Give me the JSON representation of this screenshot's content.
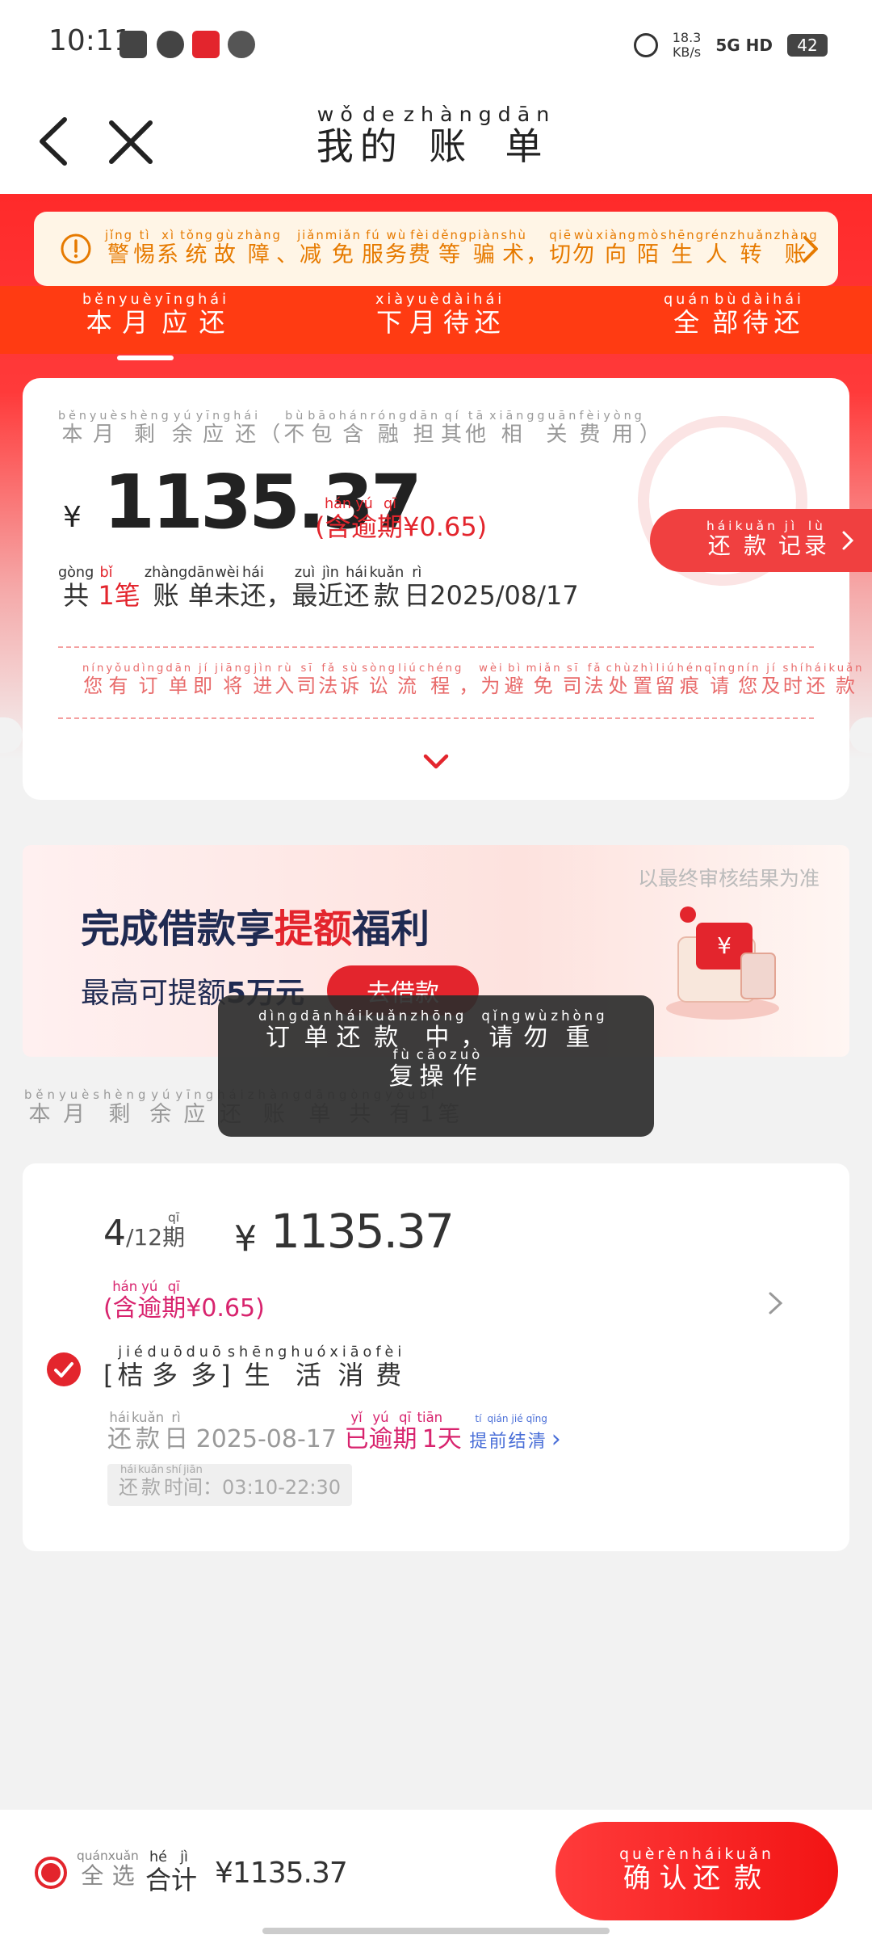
{
  "status_bar": {
    "time": "10:11",
    "speed": "18.3",
    "speed_unit": "KB/s",
    "network": "5G HD",
    "battery": "42"
  },
  "header": {
    "title": [
      [
        "我",
        "wǒ"
      ],
      [
        "的",
        "de"
      ],
      [
        "账",
        "zhàng"
      ],
      [
        "单",
        "dān"
      ]
    ]
  },
  "notice": {
    "text": [
      [
        "警",
        "jǐng"
      ],
      [
        "惕",
        "tì"
      ],
      [
        "系",
        "xì"
      ],
      [
        "统",
        "tǒng"
      ],
      [
        "故",
        "gù"
      ],
      [
        "障",
        "zhàng"
      ],
      [
        "、",
        ""
      ],
      [
        "减",
        "jiǎn"
      ],
      [
        "免",
        "miǎn"
      ],
      [
        "服",
        "fú"
      ],
      [
        "务",
        "wù"
      ],
      [
        "费",
        "fèi"
      ],
      [
        "等",
        "děng"
      ],
      [
        "骗",
        "piàn"
      ],
      [
        "术",
        "shù"
      ],
      [
        "，",
        ""
      ],
      [
        "切",
        "qiē"
      ],
      [
        "勿",
        "wù"
      ],
      [
        "向",
        "xiàng"
      ],
      [
        "陌",
        "mò"
      ],
      [
        "生",
        "shēng"
      ],
      [
        "人",
        "rén"
      ],
      [
        "转",
        "zhuǎn"
      ],
      [
        "账",
        "zhàng"
      ]
    ]
  },
  "tabs": [
    [
      [
        "本",
        "běn"
      ],
      [
        "月",
        "yuè"
      ],
      [
        "应",
        "yīng"
      ],
      [
        "还",
        "hái"
      ]
    ],
    [
      [
        "下",
        "xià"
      ],
      [
        "月",
        "yuè"
      ],
      [
        "待",
        "dài"
      ],
      [
        "还",
        "hái"
      ]
    ],
    [
      [
        "全",
        "quán"
      ],
      [
        "部",
        "bù"
      ],
      [
        "待",
        "dài"
      ],
      [
        "还",
        "hái"
      ]
    ]
  ],
  "summary": {
    "label": [
      [
        "本",
        "běn"
      ],
      [
        "月",
        "yuè"
      ],
      [
        "剩",
        "shèng"
      ],
      [
        "余",
        "yú"
      ],
      [
        "应",
        "yīng"
      ],
      [
        "还",
        "hái"
      ],
      [
        "（",
        ""
      ],
      [
        "不",
        "bù"
      ],
      [
        "包",
        "bāo"
      ],
      [
        "含",
        "hán"
      ],
      [
        "融",
        "róng"
      ],
      [
        "担",
        "dān"
      ],
      [
        "其",
        "qí"
      ],
      [
        "他",
        "tā"
      ],
      [
        "相",
        "xiāng"
      ],
      [
        "关",
        "guān"
      ],
      [
        "费",
        "fèi"
      ],
      [
        "用",
        "yòng"
      ],
      [
        "）",
        ""
      ]
    ],
    "currency": "¥",
    "amount": "1135.37",
    "overdue_prefix": [
      [
        "(",
        ""
      ],
      [
        "含",
        "hán"
      ],
      [
        "逾",
        "yú"
      ],
      [
        "期",
        "qī"
      ]
    ],
    "overdue_value": "¥0.65)",
    "history_button": [
      [
        "还",
        "hái"
      ],
      [
        "款",
        "kuǎn"
      ],
      [
        "记",
        "jì"
      ],
      [
        "录",
        "lù"
      ]
    ],
    "count_pre": [
      [
        "共",
        "gòng"
      ]
    ],
    "count_num": [
      [
        "1",
        "bǐ"
      ],
      [
        "笔",
        ""
      ]
    ],
    "count_mid": [
      [
        "账",
        "zhàng"
      ],
      [
        "单",
        "dān"
      ],
      [
        "未",
        "wèi"
      ],
      [
        "还",
        "hái"
      ],
      [
        "，",
        ""
      ],
      [
        "最",
        "zuì"
      ],
      [
        "近",
        "jìn"
      ],
      [
        "还",
        "hái"
      ],
      [
        "款",
        "kuǎn"
      ],
      [
        "日",
        "rì"
      ]
    ],
    "count_date": "2025/08/17",
    "legal_notice": [
      [
        "您",
        "nín"
      ],
      [
        "有",
        "yǒu"
      ],
      [
        "订",
        "dìng"
      ],
      [
        "单",
        "dān"
      ],
      [
        "即",
        "jí"
      ],
      [
        "将",
        "jiāng"
      ],
      [
        "进",
        "jìn"
      ],
      [
        "入",
        "rù"
      ],
      [
        "司",
        "sī"
      ],
      [
        "法",
        "fǎ"
      ],
      [
        "诉",
        "sù"
      ],
      [
        "讼",
        "sòng"
      ],
      [
        "流",
        "liú"
      ],
      [
        "程",
        "chéng"
      ],
      [
        "，",
        ""
      ],
      [
        "为",
        "wèi"
      ],
      [
        "避",
        "bì"
      ],
      [
        "免",
        "miǎn"
      ],
      [
        "司",
        "sī"
      ],
      [
        "法",
        "fǎ"
      ],
      [
        "处",
        "chù"
      ],
      [
        "置",
        "zhì"
      ],
      [
        "留",
        "liú"
      ],
      [
        "痕",
        "hén"
      ],
      [
        "请",
        "qǐng"
      ],
      [
        "您",
        "nín"
      ],
      [
        "及",
        "jí"
      ],
      [
        "时",
        "shí"
      ],
      [
        "还",
        "hái"
      ],
      [
        "款",
        "kuǎn"
      ]
    ]
  },
  "banner": {
    "disclaimer": "以最终审核结果为准",
    "title_pre": "完成借款享",
    "title_highlight": "提额",
    "title_post": "福利",
    "sub_pre": "最高可提额",
    "sub_bold": "5万元",
    "button": "去借款"
  },
  "section_label": [
    [
      "本",
      "běn"
    ],
    [
      "月",
      "yuè"
    ],
    [
      "剩",
      "shèng"
    ],
    [
      "余",
      "yú"
    ],
    [
      "应",
      "yīng"
    ],
    [
      "还",
      "hái"
    ],
    [
      "账",
      "zhàng"
    ],
    [
      "单",
      "dān"
    ],
    [
      "共",
      "gòng"
    ],
    [
      "有",
      "yǒu"
    ],
    [
      "1",
      "bǐ"
    ],
    [
      "笔",
      ""
    ]
  ],
  "toast": [
    [
      "订",
      "dìng"
    ],
    [
      "单",
      "dān"
    ],
    [
      "还",
      "hái"
    ],
    [
      "款",
      "kuǎn"
    ],
    [
      "中",
      "zhōng"
    ],
    [
      "，",
      ""
    ],
    [
      "请",
      "qǐng"
    ],
    [
      "勿",
      "wù"
    ],
    [
      "重",
      "zhòng"
    ],
    [
      "复",
      "fù"
    ],
    [
      "操",
      "cāo"
    ],
    [
      "作",
      "zuò"
    ]
  ],
  "bill": {
    "period_num": "4",
    "period_total": "/12",
    "period_unit": [
      [
        "期",
        "qī"
      ]
    ],
    "currency": "¥",
    "amount": "1135.37",
    "overdue_prefix": [
      [
        "(",
        ""
      ],
      [
        "含",
        "hán"
      ],
      [
        "逾",
        "yú"
      ],
      [
        "期",
        "qī"
      ]
    ],
    "overdue_value": "¥0.65)",
    "product_bracket": [
      [
        "[",
        ""
      ],
      [
        "桔",
        "jié"
      ],
      [
        "多",
        "duō"
      ],
      [
        "多",
        "duō"
      ],
      [
        "]",
        ""
      ]
    ],
    "product_name": [
      [
        "生",
        "shēng"
      ],
      [
        "活",
        "huó"
      ],
      [
        "消",
        "xiāo"
      ],
      [
        "费",
        "fèi"
      ]
    ],
    "due_label": [
      [
        "还",
        "hái"
      ],
      [
        "款",
        "kuǎn"
      ],
      [
        "日",
        "rì"
      ]
    ],
    "due_date": "2025-08-17",
    "overdue_status": [
      [
        "已",
        "yǐ"
      ],
      [
        "逾",
        "yú"
      ],
      [
        "期",
        "qī"
      ],
      [
        "1",
        "tiān"
      ],
      [
        "天",
        ""
      ]
    ],
    "prepay_link": [
      [
        "提",
        "tí"
      ],
      [
        "前",
        "qián"
      ],
      [
        "结",
        "jié"
      ],
      [
        "清",
        "qīng"
      ]
    ],
    "repay_time_label": [
      [
        "还",
        "hái"
      ],
      [
        "款",
        "kuǎn"
      ],
      [
        "时",
        "shí"
      ],
      [
        "间",
        "jiān"
      ],
      [
        "：",
        ""
      ]
    ],
    "repay_time_value": "03:10-22:30"
  },
  "bottom_bar": {
    "select_all": [
      [
        "全",
        "quán"
      ],
      [
        "选",
        "xuǎn"
      ]
    ],
    "total_label": [
      [
        "合",
        "hé"
      ],
      [
        "计",
        "jì"
      ]
    ],
    "total_amount": "¥1135.37",
    "confirm_button": [
      [
        "确",
        "què"
      ],
      [
        "认",
        "rèn"
      ],
      [
        "还",
        "hái"
      ],
      [
        "款",
        "kuǎn"
      ]
    ]
  },
  "colors": {
    "brand_red": "#e3252d",
    "tab_red": "#ff3b12",
    "notice_orange": "#e67a00",
    "overdue_pink": "#d8246e",
    "link_blue": "#4a6fd8"
  },
  "icons": [
    "calendar-icon",
    "message-icon",
    "app-icon",
    "wechat-icon",
    "alarm-icon",
    "back-icon",
    "close-icon",
    "warning-icon",
    "chevron-right-icon",
    "chevron-down-icon",
    "check-icon",
    "gift-icon"
  ]
}
